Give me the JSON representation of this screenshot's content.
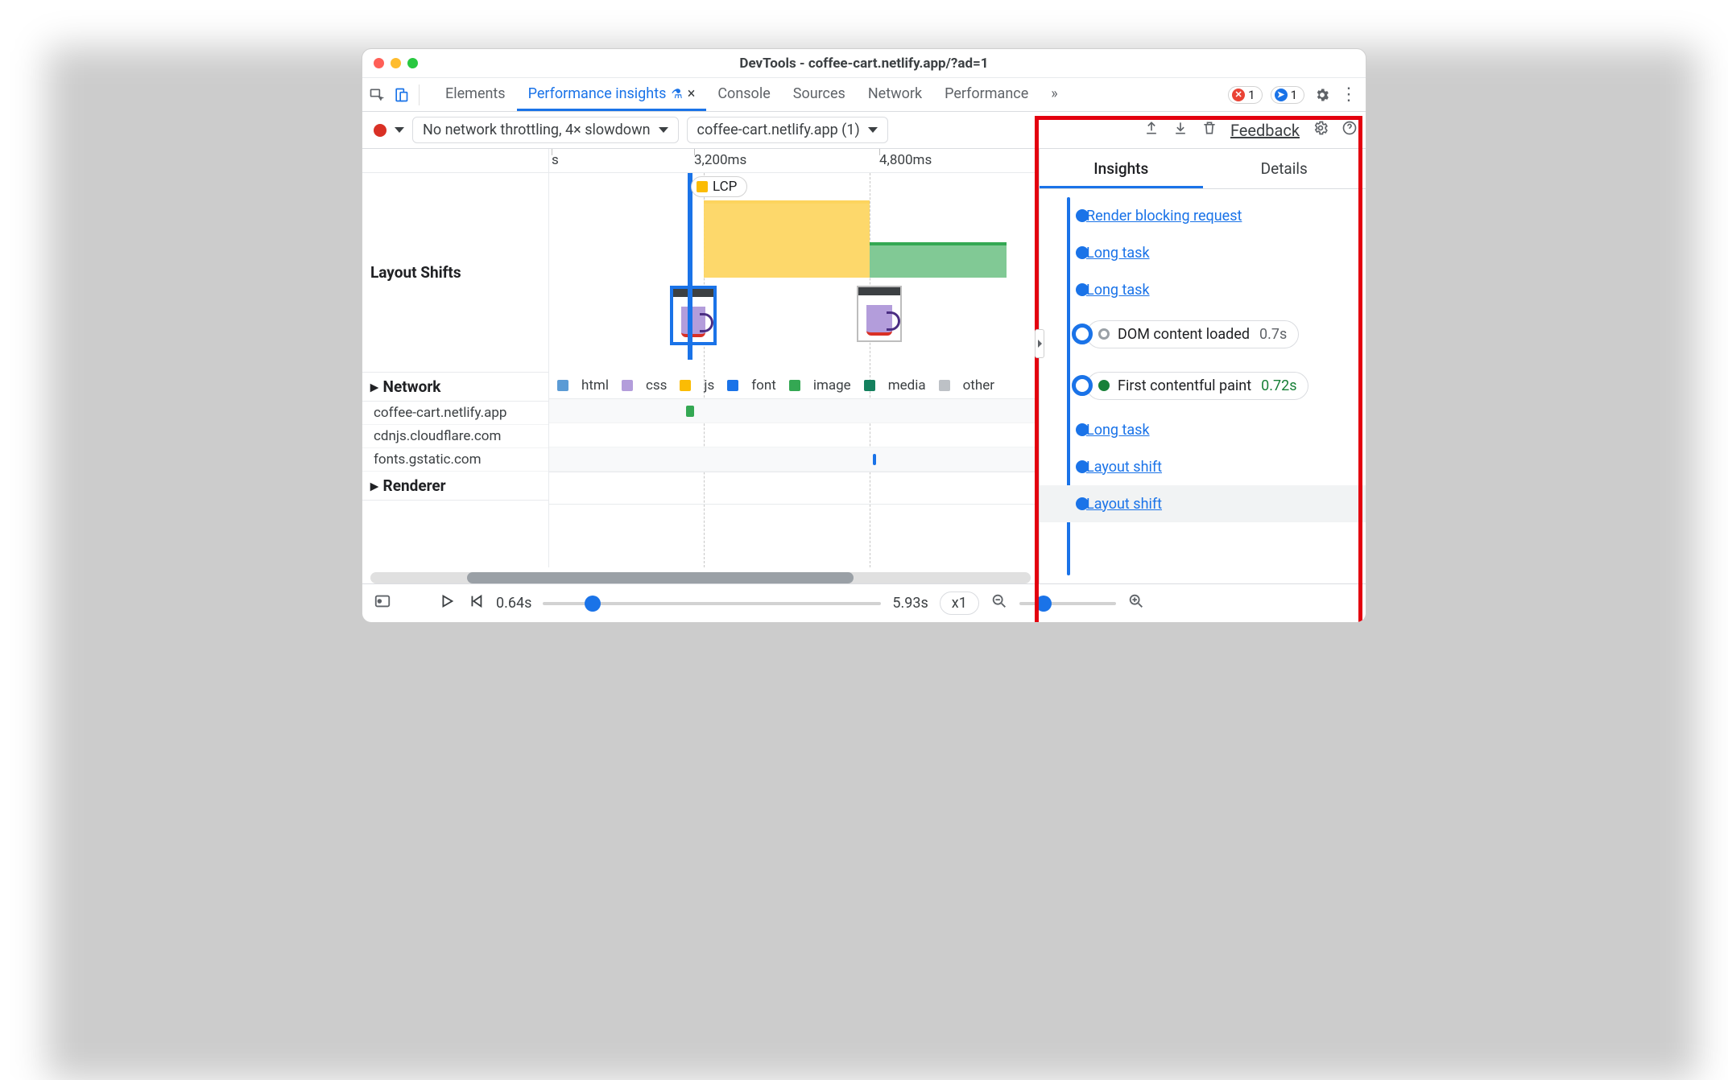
{
  "window": {
    "title": "DevTools - coffee-cart.netlify.app/?ad=1"
  },
  "tabs": {
    "elements": "Elements",
    "perf_insights": "Performance insights",
    "console": "Console",
    "sources": "Sources",
    "network": "Network",
    "performance": "Performance",
    "more": "»"
  },
  "toolbar_badges": {
    "errors": "1",
    "messages": "1"
  },
  "subbar": {
    "throttle": "No network throttling, 4× slowdown",
    "recording": "coffee-cart.netlify.app (1)",
    "feedback": "Feedback"
  },
  "ruler": {
    "s": "s",
    "t3200": "3,200ms",
    "t4800": "4,800ms"
  },
  "lcp_label": "LCP",
  "sections": {
    "layout_shifts": "Layout Shifts",
    "network": "Network",
    "renderer": "Renderer"
  },
  "network_hosts": {
    "h1": "coffee-cart.netlify.app",
    "h2": "cdnjs.cloudflare.com",
    "h3": "fonts.gstatic.com"
  },
  "net_legend": {
    "html": "html",
    "css": "css",
    "js": "js",
    "font": "font",
    "image": "image",
    "media": "media",
    "other": "other"
  },
  "right": {
    "tab_insights": "Insights",
    "tab_details": "Details",
    "items": {
      "render_blocking": "Render blocking request",
      "long_task": "Long task",
      "dcl_label": "DOM content loaded",
      "dcl_time": "0.7s",
      "fcp_label": "First contentful paint",
      "fcp_time": "0.72s",
      "layout_shift": "Layout shift"
    }
  },
  "footer": {
    "start": "0.64s",
    "end": "5.93s",
    "zoom": "x1"
  }
}
